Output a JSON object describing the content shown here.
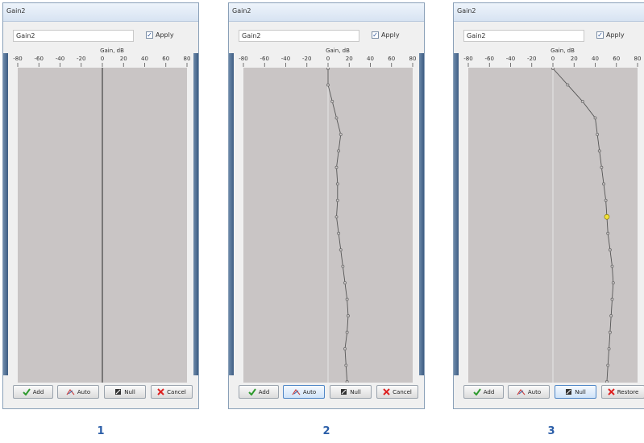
{
  "dialogs": [
    {
      "title": "Gain2",
      "name_value": "Gain2",
      "apply_label": "Apply",
      "apply_checked": true,
      "axis_label": "Gain, dB",
      "ticks": [
        "-80",
        "-60",
        "-40",
        "-20",
        "0",
        "20",
        "40",
        "60",
        "80"
      ],
      "curve_gain_db": [
        0,
        0,
        0,
        0,
        0,
        0,
        0,
        0,
        0,
        0,
        0,
        0,
        0,
        0,
        0,
        0,
        0,
        0,
        0,
        0
      ],
      "buttons": [
        {
          "label": "Add",
          "icon": "checkmark-icon"
        },
        {
          "label": "Auto",
          "icon": "auto-curve-icon"
        },
        {
          "label": "Null",
          "icon": "null-icon"
        },
        {
          "label": "Cancel",
          "icon": "cross-icon"
        }
      ],
      "caption": "1"
    },
    {
      "title": "Gain2",
      "name_value": "Gain2",
      "apply_label": "Apply",
      "apply_checked": true,
      "axis_label": "Gain, dB",
      "ticks": [
        "-80",
        "-60",
        "-40",
        "-20",
        "0",
        "20",
        "40",
        "60",
        "80"
      ],
      "curve_gain_db": [
        0,
        0,
        4,
        8,
        12,
        10,
        8,
        9,
        9,
        8,
        10,
        12,
        14,
        16,
        18,
        19,
        18,
        16,
        17,
        18
      ],
      "buttons": [
        {
          "label": "Add",
          "icon": "checkmark-icon"
        },
        {
          "label": "Auto",
          "icon": "auto-curve-icon"
        },
        {
          "label": "Null",
          "icon": "null-icon"
        },
        {
          "label": "Cancel",
          "icon": "cross-icon"
        }
      ],
      "caption": "2"
    },
    {
      "title": "Gain2",
      "name_value": "Gain2",
      "apply_label": "Apply",
      "apply_checked": true,
      "axis_label": "Gain, dB",
      "ticks": [
        "-80",
        "-60",
        "-40",
        "-20",
        "0",
        "20",
        "40",
        "60",
        "80"
      ],
      "curve_gain_db": [
        0,
        14,
        28,
        40,
        42,
        44,
        46,
        48,
        50,
        51,
        52,
        54,
        56,
        57,
        56,
        55,
        54,
        53,
        52,
        51
      ],
      "buttons": [
        {
          "label": "Add",
          "icon": "checkmark-icon"
        },
        {
          "label": "Auto",
          "icon": "auto-curve-icon"
        },
        {
          "label": "Null",
          "icon": "null-icon"
        },
        {
          "label": "Restore",
          "icon": "cross-icon"
        }
      ],
      "caption": "3"
    }
  ]
}
